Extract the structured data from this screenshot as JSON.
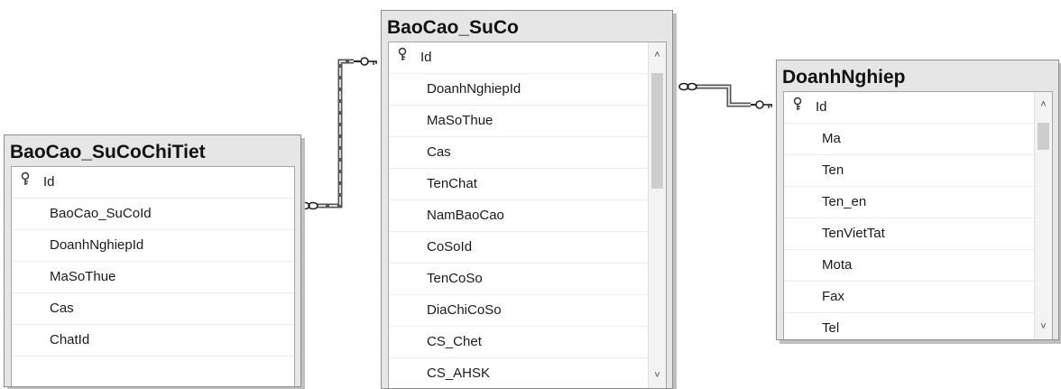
{
  "tables": [
    {
      "id": "baocao-suco-chitiet",
      "title": "BaoCao_SuCoChiTiet",
      "columns": [
        {
          "name": "Id",
          "pk": true
        },
        {
          "name": "BaoCao_SuCoId",
          "pk": false
        },
        {
          "name": "DoanhNghiepId",
          "pk": false
        },
        {
          "name": "MaSoThue",
          "pk": false
        },
        {
          "name": "Cas",
          "pk": false
        },
        {
          "name": "ChatId",
          "pk": false
        }
      ],
      "scrollbar": false
    },
    {
      "id": "baocao-suco",
      "title": "BaoCao_SuCo",
      "columns": [
        {
          "name": "Id",
          "pk": true
        },
        {
          "name": "DoanhNghiepId",
          "pk": false
        },
        {
          "name": "MaSoThue",
          "pk": false
        },
        {
          "name": "Cas",
          "pk": false
        },
        {
          "name": "TenChat",
          "pk": false
        },
        {
          "name": "NamBaoCao",
          "pk": false
        },
        {
          "name": "CoSoId",
          "pk": false
        },
        {
          "name": "TenCoSo",
          "pk": false
        },
        {
          "name": "DiaChiCoSo",
          "pk": false
        },
        {
          "name": "CS_Chet",
          "pk": false
        },
        {
          "name": "CS_AHSK",
          "pk": false
        }
      ],
      "scrollbar": true
    },
    {
      "id": "doanhnghiep",
      "title": "DoanhNghiep",
      "columns": [
        {
          "name": "Id",
          "pk": true
        },
        {
          "name": "Ma",
          "pk": false
        },
        {
          "name": "Ten",
          "pk": false
        },
        {
          "name": "Ten_en",
          "pk": false
        },
        {
          "name": "TenVietTat",
          "pk": false
        },
        {
          "name": "Mota",
          "pk": false
        },
        {
          "name": "Fax",
          "pk": false
        },
        {
          "name": "Tel",
          "pk": false
        }
      ],
      "scrollbar": true
    }
  ],
  "relationships": [
    {
      "from": "BaoCao_SuCoChiTiet",
      "to": "BaoCao_SuCo",
      "many_side": "infinity-icon",
      "one_side": "key-icon"
    },
    {
      "from": "BaoCao_SuCo",
      "to": "DoanhNghiep",
      "many_side": "infinity-icon",
      "one_side": "key-icon"
    }
  ],
  "icons": {
    "primary_key": "key-icon",
    "scroll_up": "chevron-up-icon",
    "scroll_down": "chevron-down-icon"
  }
}
